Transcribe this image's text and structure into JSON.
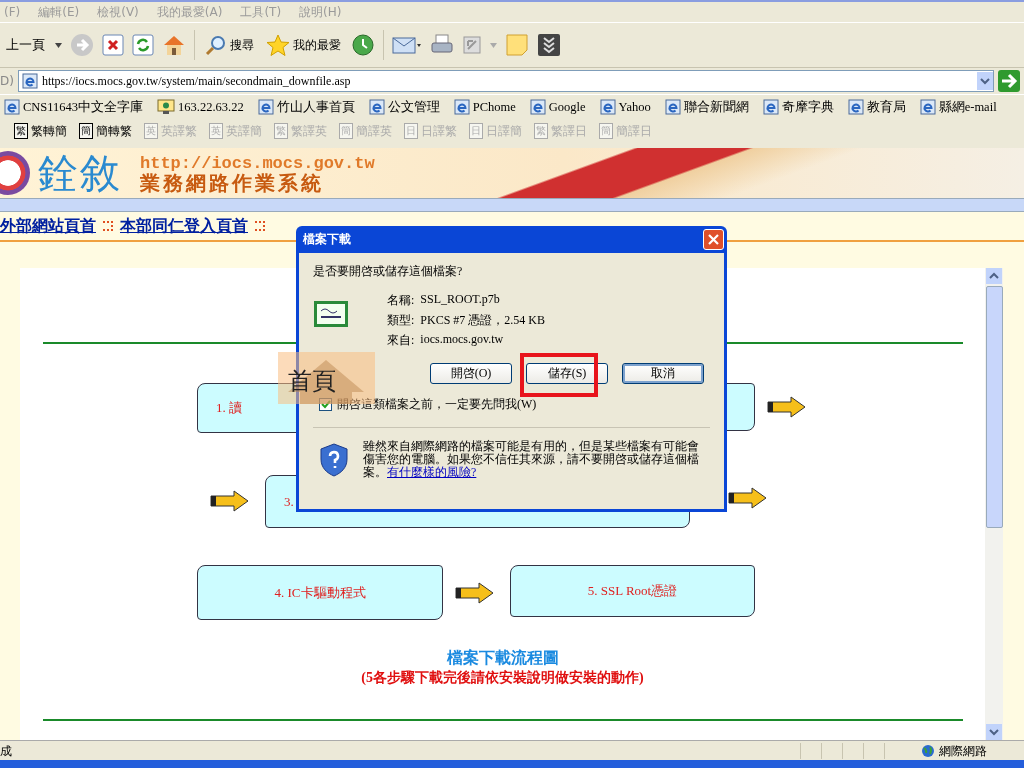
{
  "menu": [
    {
      "label": "(F)"
    },
    {
      "label": "編輯(E)"
    },
    {
      "label": "檢視(V)"
    },
    {
      "label": "我的最愛(A)"
    },
    {
      "label": "工具(T)"
    },
    {
      "label": "說明(H)"
    }
  ],
  "toolbar": {
    "back": "上一頁",
    "search": "搜尋",
    "favorites": "我的最愛"
  },
  "address": {
    "label": "D)",
    "value": "https://iocs.mocs.gov.tw/system/main/secondmain_downfile.asp"
  },
  "links": [
    {
      "label": "CNS11643中文全字庫",
      "kind": "page"
    },
    {
      "label": "163.22.63.22",
      "kind": "site"
    },
    {
      "label": "竹山人事首頁",
      "kind": "page"
    },
    {
      "label": "公文管理",
      "kind": "page"
    },
    {
      "label": "PChome",
      "kind": "page"
    },
    {
      "label": "Google",
      "kind": "page"
    },
    {
      "label": "Yahoo",
      "kind": "page"
    },
    {
      "label": "聯合新聞網",
      "kind": "page"
    },
    {
      "label": "奇摩字典",
      "kind": "page"
    },
    {
      "label": "教育局",
      "kind": "page"
    },
    {
      "label": "縣網e-mail",
      "kind": "page"
    }
  ],
  "translate": [
    {
      "icon": "繁",
      "label": "繁轉簡",
      "disabled": false
    },
    {
      "icon": "簡",
      "label": "簡轉繁",
      "disabled": false
    },
    {
      "icon": "英",
      "label": "英譯繁",
      "disabled": true
    },
    {
      "icon": "英",
      "label": "英譯簡",
      "disabled": true
    },
    {
      "icon": "繁",
      "label": "繁譯英",
      "disabled": true
    },
    {
      "icon": "簡",
      "label": "簡譯英",
      "disabled": true
    },
    {
      "icon": "日",
      "label": "日譯繁",
      "disabled": true
    },
    {
      "icon": "日",
      "label": "日譯簡",
      "disabled": true
    },
    {
      "icon": "繁",
      "label": "繁譯日",
      "disabled": true
    },
    {
      "icon": "簡",
      "label": "簡譯日",
      "disabled": true
    }
  ],
  "banner": {
    "logo": "銓敘",
    "url": "http://iocs.mocs.gov.tw",
    "title": "業務網路作業系統"
  },
  "nav": [
    {
      "label": "外部網站頁首"
    },
    {
      "label": "本部同仁登入頁首"
    }
  ],
  "flow": {
    "steps": [
      {
        "label": "1. 讀"
      },
      {
        "label": "3."
      },
      {
        "label": "4. IC卡驅動程式"
      },
      {
        "label": "5. SSL Root憑證"
      }
    ],
    "title": "檔案下載流程圖",
    "note": "(5各步驟下載完後請依安裝說明做安裝的動作)"
  },
  "home_badge": {
    "label": "首頁"
  },
  "dialog": {
    "title": "檔案下載",
    "question": "是否要開啓或儲存這個檔案?",
    "fields": [
      {
        "label": "名稱:",
        "value": "SSL_ROOT.p7b"
      },
      {
        "label": "類型:",
        "value": "PKCS #7 憑證，2.54 KB"
      },
      {
        "label": "來自:",
        "value": "iocs.mocs.gov.tw"
      }
    ],
    "buttons": [
      {
        "label": "開啓(O)",
        "highlighted": false,
        "focused": false
      },
      {
        "label": "儲存(S)",
        "highlighted": true,
        "focused": false
      },
      {
        "label": "取消",
        "highlighted": false,
        "focused": true
      }
    ],
    "checkbox": {
      "label": "開啓這類檔案之前，一定要先問我(W)",
      "checked": true
    },
    "warning": "雖然來自網際網路的檔案可能是有用的，但是某些檔案有可能會傷害您的電腦。如果您不信任其來源，請不要開啓或儲存這個檔案。",
    "warning_link": "有什麼樣的風險?"
  },
  "status": {
    "text": "成",
    "zone": "網際網路"
  }
}
